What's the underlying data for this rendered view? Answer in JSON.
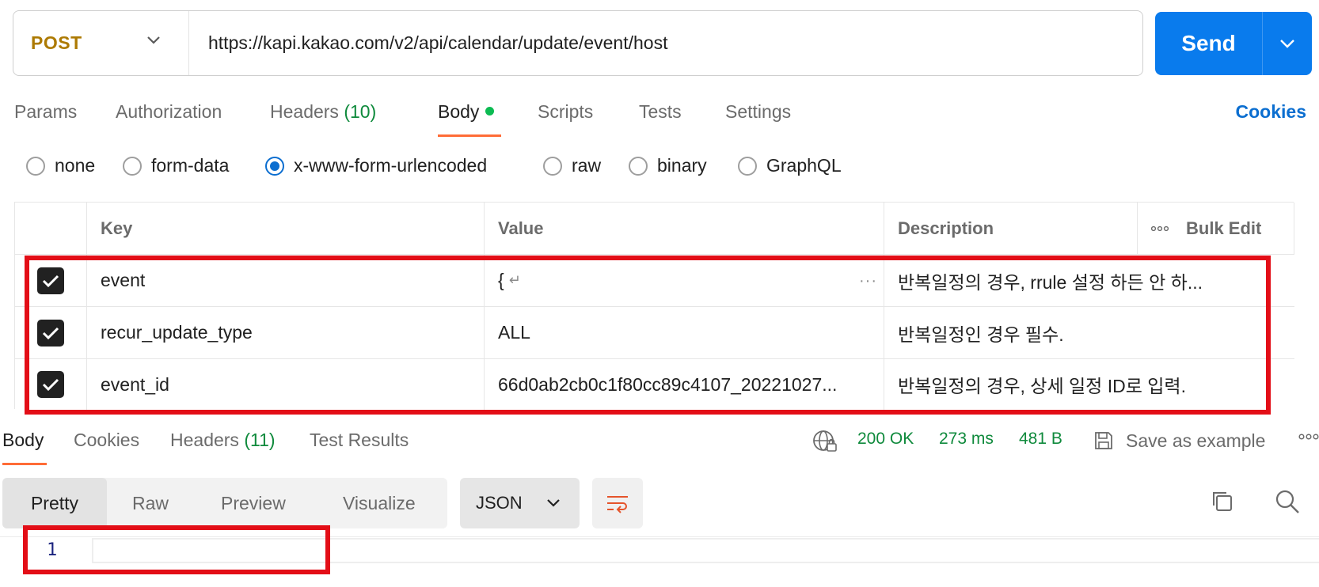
{
  "request": {
    "method": "POST",
    "url": "https://kapi.kakao.com/v2/api/calendar/update/event/host",
    "send_label": "Send"
  },
  "request_tabs": [
    {
      "label": "Params"
    },
    {
      "label": "Authorization"
    },
    {
      "label": "Headers",
      "count": "(10)"
    },
    {
      "label": "Body"
    },
    {
      "label": "Scripts"
    },
    {
      "label": "Tests"
    },
    {
      "label": "Settings"
    }
  ],
  "cookies_label": "Cookies",
  "body_types": [
    {
      "label": "none",
      "selected": false
    },
    {
      "label": "form-data",
      "selected": false
    },
    {
      "label": "x-www-form-urlencoded",
      "selected": true
    },
    {
      "label": "raw",
      "selected": false
    },
    {
      "label": "binary",
      "selected": false
    },
    {
      "label": "GraphQL",
      "selected": false
    }
  ],
  "params_table": {
    "headers": {
      "key": "Key",
      "value": "Value",
      "description": "Description",
      "bulk_edit": "Bulk Edit"
    },
    "rows": [
      {
        "checked": true,
        "key": "event",
        "value": "{",
        "description": "반복일정의 경우, rrule 설정 하든 안 하..."
      },
      {
        "checked": true,
        "key": "recur_update_type",
        "value": "ALL",
        "description": "반복일정인 경우 필수."
      },
      {
        "checked": true,
        "key": "event_id",
        "value": "66d0ab2cb0c1f80cc89c4107_20221027...",
        "description": "반복일정의 경우, 상세 일정 ID로 입력."
      }
    ]
  },
  "response_tabs": [
    {
      "label": "Body"
    },
    {
      "label": "Cookies"
    },
    {
      "label": "Headers",
      "count": "(11)"
    },
    {
      "label": "Test Results"
    }
  ],
  "response_status": {
    "code": "200 OK",
    "time": "273 ms",
    "size": "481 B"
  },
  "save_example_label": "Save as example",
  "view_modes": [
    "Pretty",
    "Raw",
    "Preview",
    "Visualize"
  ],
  "format": "JSON",
  "editor": {
    "line_numbers": [
      "1"
    ]
  },
  "colors": {
    "send_blue": "#097bed",
    "method_post": "#ad7a03",
    "accent_orange": "#ff6c37",
    "status_green": "#0f8a3c",
    "highlight_red": "#e30e17"
  }
}
